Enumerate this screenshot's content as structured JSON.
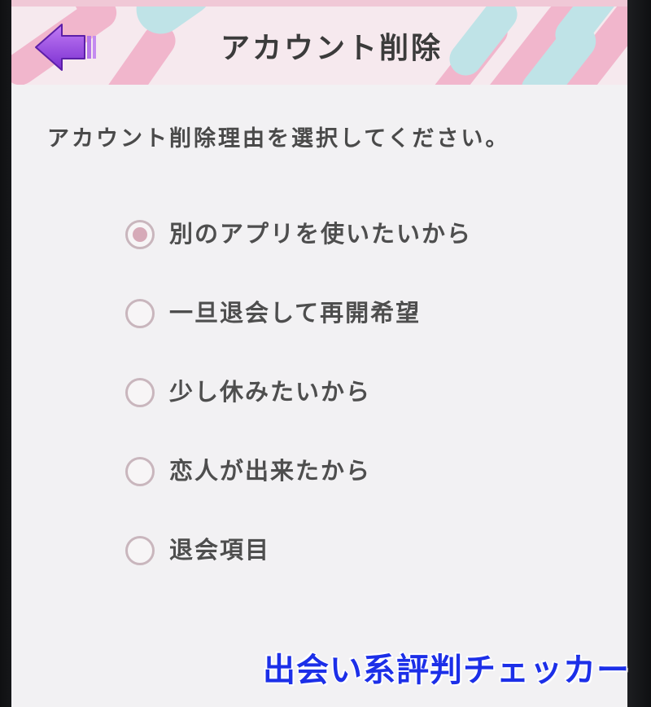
{
  "header": {
    "title": "アカウント削除",
    "back_icon": "arrow-left-icon"
  },
  "prompt": "アカウント削除理由を選択してください。",
  "options": [
    {
      "label": "別のアプリを使いたいから",
      "selected": true
    },
    {
      "label": "一旦退会して再開希望",
      "selected": false
    },
    {
      "label": "少し休みたいから",
      "selected": false
    },
    {
      "label": "恋人が出来たから",
      "selected": false
    },
    {
      "label": "退会項目",
      "selected": false
    }
  ],
  "watermark": "出会い系評判チェッカー",
  "colors": {
    "header_background": "#f6e9ee",
    "header_stripe_pink": "#f1b6cc",
    "header_stripe_teal": "#bfe3e7",
    "back_arrow": "#9b4fe0",
    "radio_border": "#c9b6bd",
    "radio_selected": "#d6aab8",
    "watermark": "#1c2fe8"
  }
}
